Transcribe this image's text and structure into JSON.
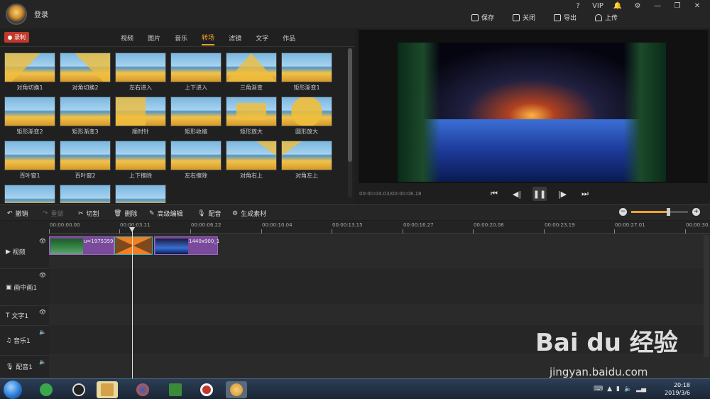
{
  "header": {
    "login_label": "登录",
    "window_controls": [
      "?",
      "VIP",
      "🔔",
      "⚙",
      "—",
      "❐",
      "✕"
    ],
    "actions": [
      {
        "label": "保存",
        "icon": "save-icon"
      },
      {
        "label": "关闭",
        "icon": "close-file-icon"
      },
      {
        "label": "导出",
        "icon": "export-icon"
      },
      {
        "label": "上传",
        "icon": "upload-icon"
      }
    ]
  },
  "library": {
    "record_label": "录制",
    "tabs": [
      "视频",
      "图片",
      "音乐",
      "转场",
      "滤镜",
      "文字",
      "作品"
    ],
    "active_tab": "转场",
    "transitions": [
      "对角切换1",
      "对角切换2",
      "左右进入",
      "上下进入",
      "三角渐变",
      "矩形渐变1",
      "矩形渐变2",
      "矩形渐变3",
      "顺时针",
      "矩形收缩",
      "矩形放大",
      "圆形放大",
      "百叶窗1",
      "百叶窗2",
      "上下擦除",
      "左右擦除",
      "对角右上",
      "对角左上",
      "",
      "",
      ""
    ]
  },
  "preview": {
    "timecode": "00:00:04.03/00:00:08.18"
  },
  "edit_toolbar": {
    "undo": "撤销",
    "redo": "重做",
    "cut": "切割",
    "delete": "删除",
    "advanced": "高级编辑",
    "dub": "配音",
    "generate": "生成素材",
    "zoom_level": 0.64
  },
  "ruler": {
    "ticks": [
      "00:00:00.00",
      "00:00:03.11",
      "00:00:06.22",
      "00:00:10.04",
      "00:00:13.15",
      "00:00:16.27",
      "00:00:20.08",
      "00:00:23.19",
      "00:00:27.01",
      "00:00:30."
    ]
  },
  "tracks": [
    {
      "label": "视频",
      "icon": "video-icon"
    },
    {
      "label": "画中画1",
      "icon": "pip-icon"
    },
    {
      "label": "文字1",
      "icon": "text-icon"
    },
    {
      "label": "音乐1",
      "icon": "music-icon"
    },
    {
      "label": "配音1",
      "icon": "mic-icon"
    }
  ],
  "clips": {
    "clip1_name": "u=1975359",
    "clip2_name": "1440x900_1"
  },
  "taskbar": {
    "time": "20:18",
    "date": "2019/3/6"
  },
  "watermark": {
    "brand": "Bai du 经验",
    "url": "jingyan.baidu.com"
  },
  "colors": {
    "accent": "#f0a030",
    "record": "#c0392b",
    "clip": "#7a4a9c",
    "transition": "#f08020"
  }
}
